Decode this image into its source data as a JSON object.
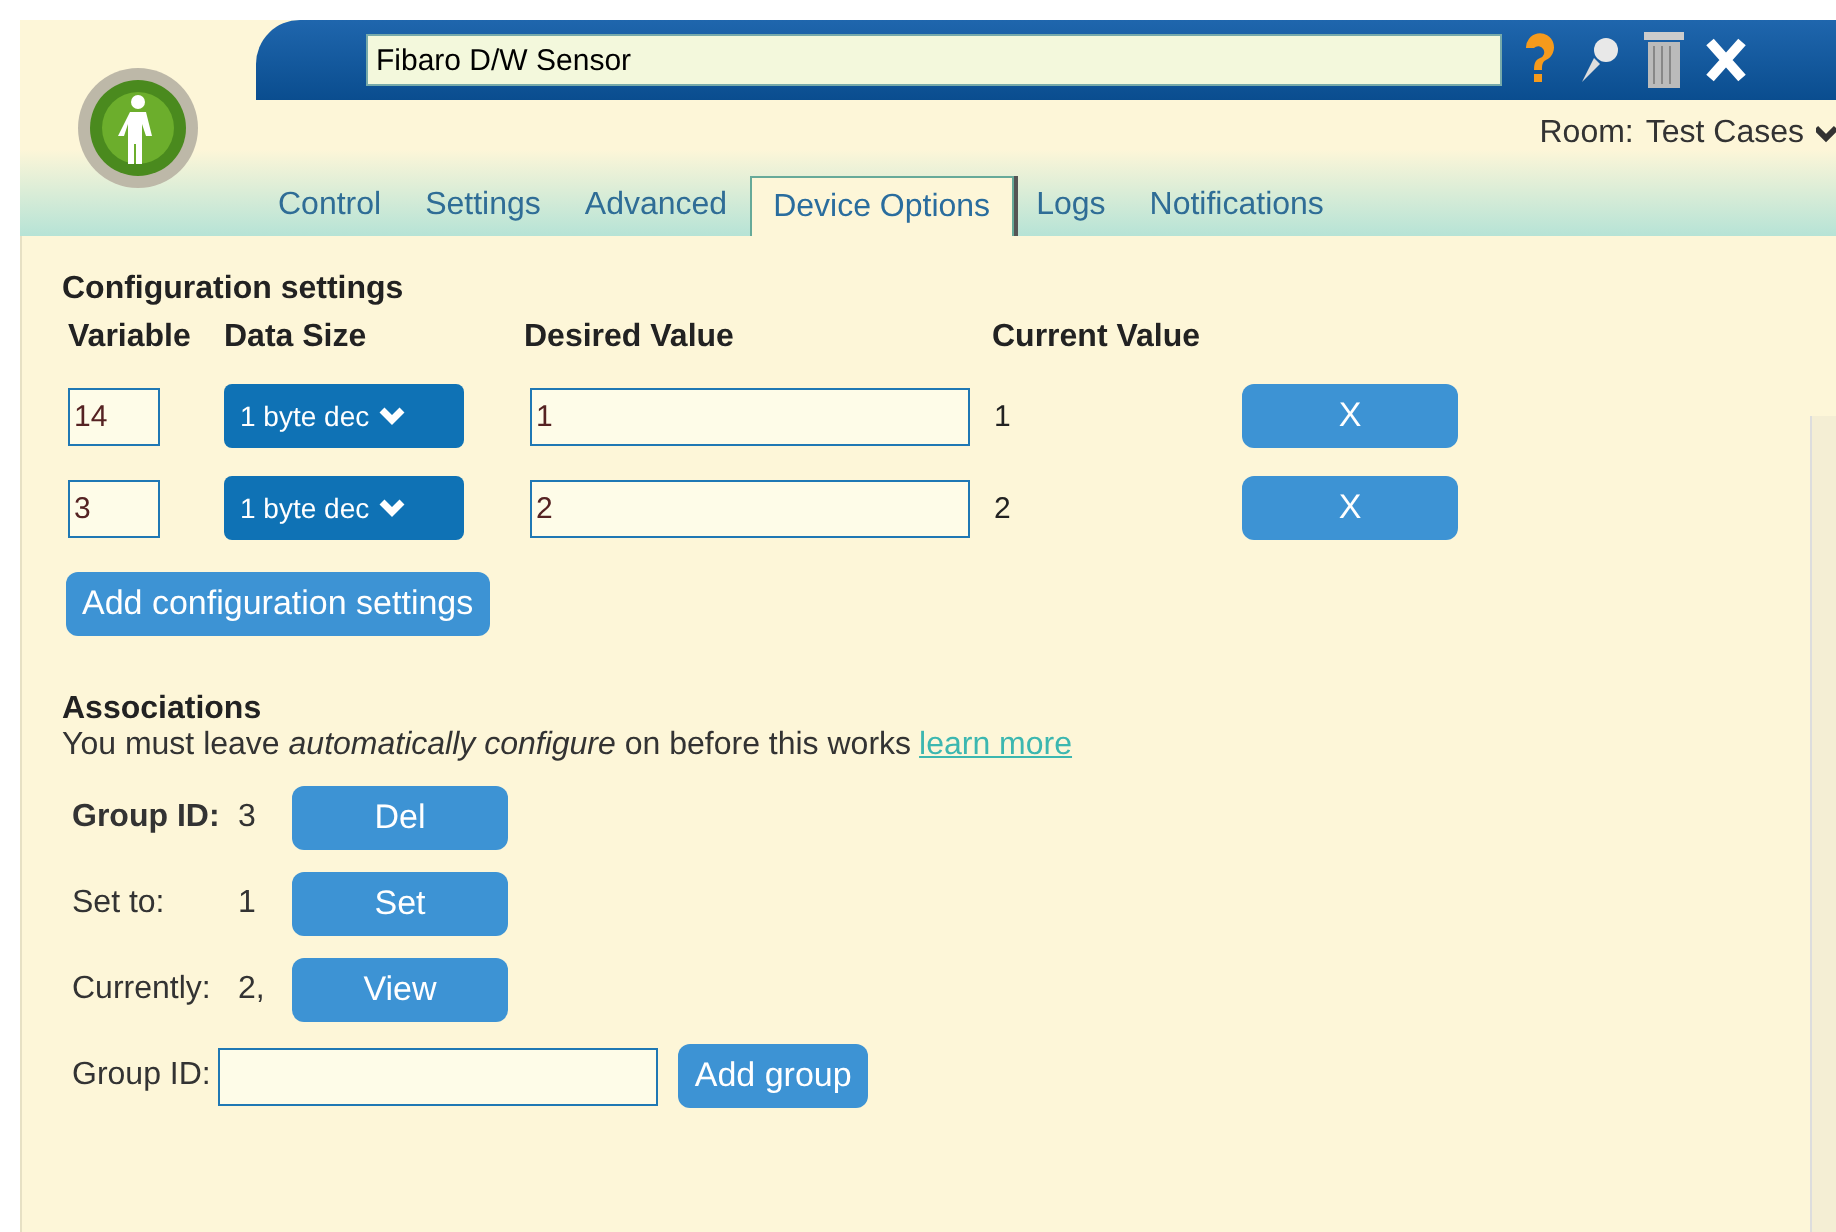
{
  "device_name": "Fibaro D/W Sensor",
  "room": {
    "label": "Room:",
    "value": "Test Cases"
  },
  "tabs": [
    {
      "label": "Control",
      "selected": false
    },
    {
      "label": "Settings",
      "selected": false
    },
    {
      "label": "Advanced",
      "selected": false
    },
    {
      "label": "Device Options",
      "selected": true
    },
    {
      "label": "Logs",
      "selected": false
    },
    {
      "label": "Notifications",
      "selected": false
    }
  ],
  "config": {
    "title": "Configuration settings",
    "columns": [
      "Variable",
      "Data Size",
      "Desired Value",
      "Current Value"
    ],
    "rows": [
      {
        "variable": "14",
        "data_size": "1 byte dec",
        "desired": "1",
        "current": "1",
        "remove": "X"
      },
      {
        "variable": "3",
        "data_size": "1 byte dec",
        "desired": "2",
        "current": "2",
        "remove": "X"
      }
    ],
    "add_button": "Add configuration settings"
  },
  "associations": {
    "title": "Associations",
    "note": "You must leave *automatically configure* on before this works",
    "link": "learn more",
    "rows": [
      {
        "label": "Group ID:",
        "bold": true,
        "value": "3",
        "button": "Del"
      },
      {
        "label": "Set to:",
        "bold": false,
        "value": "1",
        "button": "Set"
      },
      {
        "label": "Currently:",
        "bold": false,
        "value": "2,",
        "button": "View"
      }
    ],
    "new_group": {
      "label": "Group ID:",
      "button": "Add group"
    }
  }
}
